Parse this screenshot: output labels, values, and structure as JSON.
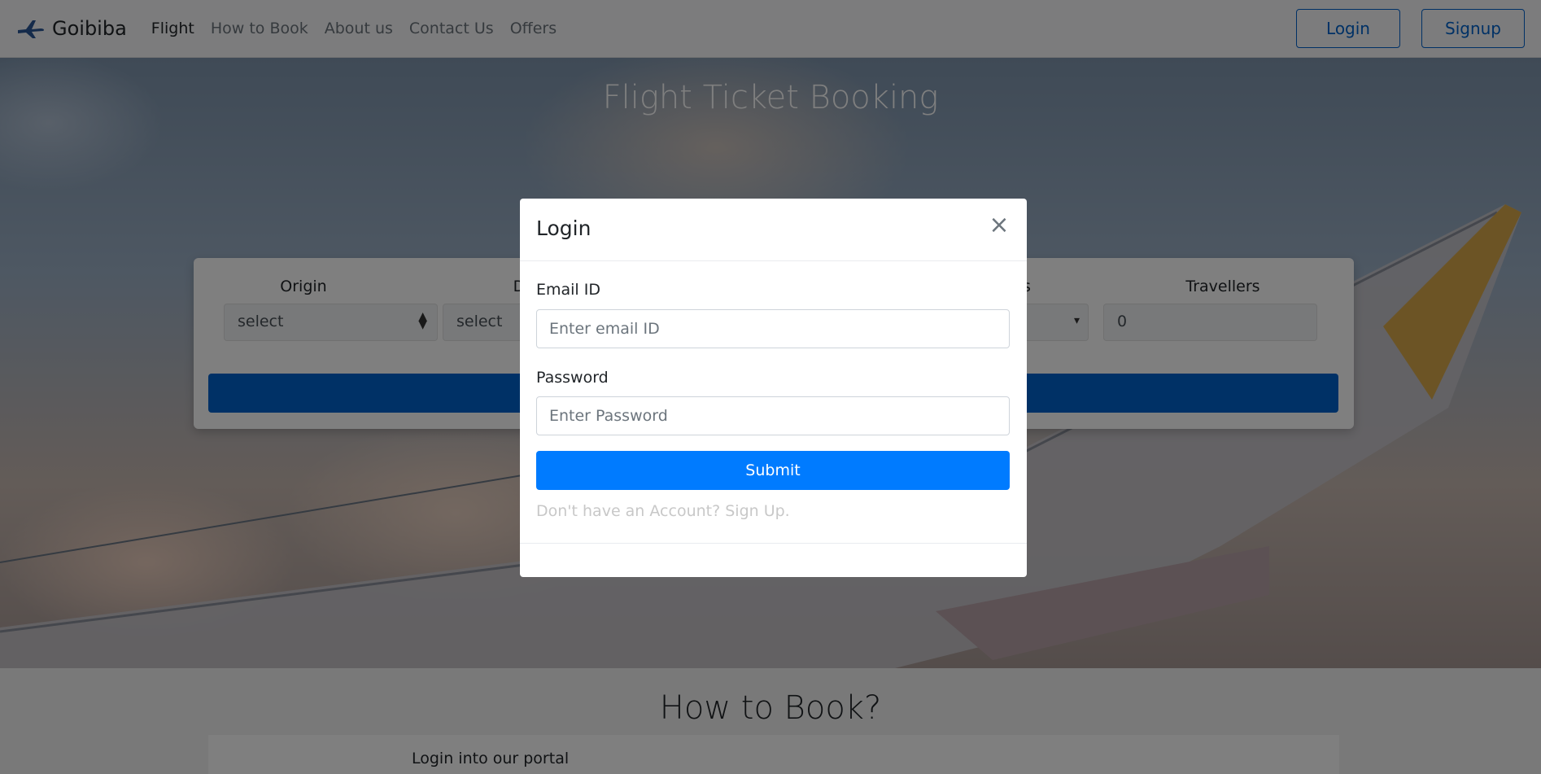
{
  "navbar": {
    "brand": "Goibiba",
    "links": [
      "Flight",
      "How to Book",
      "About us",
      "Contact Us",
      "Offers"
    ],
    "login_label": "Login",
    "signup_label": "Signup"
  },
  "hero": {
    "title": "Flight Ticket Booking",
    "search": {
      "origin_label": "Origin",
      "destination_label": "D",
      "class_label": "s",
      "travellers_label": "Travellers",
      "origin_value": "select",
      "destination_value": "select",
      "travellers_value": "0"
    }
  },
  "howto": {
    "title": "How to Book?",
    "step1": "Login into our portal"
  },
  "modal": {
    "title": "Login",
    "close": "×",
    "email_label": "Email ID",
    "email_placeholder": "Enter email ID",
    "password_label": "Password",
    "password_placeholder": "Enter Password",
    "submit_label": "Submit",
    "signup_text": "Don't have an Account? Sign Up."
  },
  "colors": {
    "primary": "#007bff",
    "primary_dark": "#0062cc",
    "backdrop": "rgba(0,0,0,0.5)"
  },
  "icons": {
    "brand_icon": "airplane-icon",
    "select_arrow": "sort-arrows-icon",
    "close": "close-icon"
  }
}
